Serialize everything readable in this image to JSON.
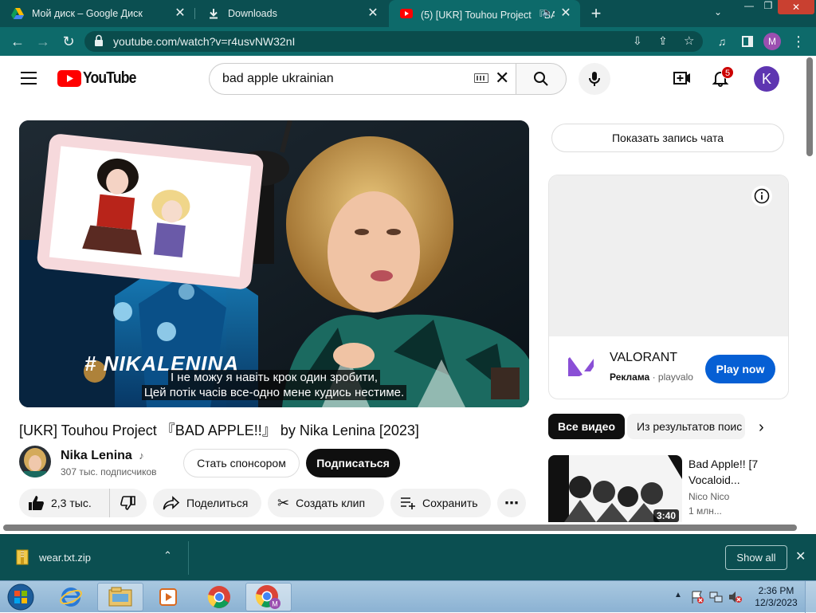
{
  "browser": {
    "tabs": [
      {
        "title": "Мой диск – Google Диск",
        "icon": "google-drive-icon"
      },
      {
        "title": "Downloads",
        "icon": "download-icon"
      },
      {
        "title": "(5) [UKR] Touhou Project 『BA",
        "icon": "youtube-icon",
        "active": true
      }
    ],
    "url": "youtube.com/watch?v=r4usvNW32nI",
    "profile_initial": "M"
  },
  "youtube": {
    "logo_text": "YouTube",
    "search_value": "bad apple ukrainian",
    "notifications_count": "5",
    "avatar_initial": "K",
    "video": {
      "watermark": "# NIKALENINA",
      "subtitle_line1": "І не можу я навіть крок один зробити,",
      "subtitle_line2": "Цей потік часів все-одно мене кудись нестиме.",
      "title": "[UKR] Touhou Project 『BAD APPLE!!』 by Nika Lenina [2023]"
    },
    "channel": {
      "name": "Nika Lenina",
      "subscribers": "307 тыс. подписчиков",
      "sponsor_label": "Стать спонсором",
      "subscribe_label": "Подписаться"
    },
    "actions": {
      "likes": "2,3 тыс.",
      "share_label": "Поделиться",
      "clip_label": "Создать клип",
      "save_label": "Сохранить"
    },
    "sidebar": {
      "chat_label": "Показать запись чата",
      "ad": {
        "brand": "VALORANT",
        "ad_label": "Реклама",
        "advertiser": "playvalo",
        "cta": "Play now"
      },
      "chips": [
        "Все видео",
        "Из результатов поис"
      ],
      "rec": {
        "title_line1": "Bad Apple!! [7",
        "title_line2": "Vocaloid...",
        "channel": "Nico Nico",
        "views": "1 млн...",
        "duration": "3:40"
      }
    }
  },
  "downloads": {
    "file": "wear.txt.zip",
    "show_all": "Show all"
  },
  "taskbar": {
    "time": "2:36 PM",
    "date": "12/3/2023"
  }
}
